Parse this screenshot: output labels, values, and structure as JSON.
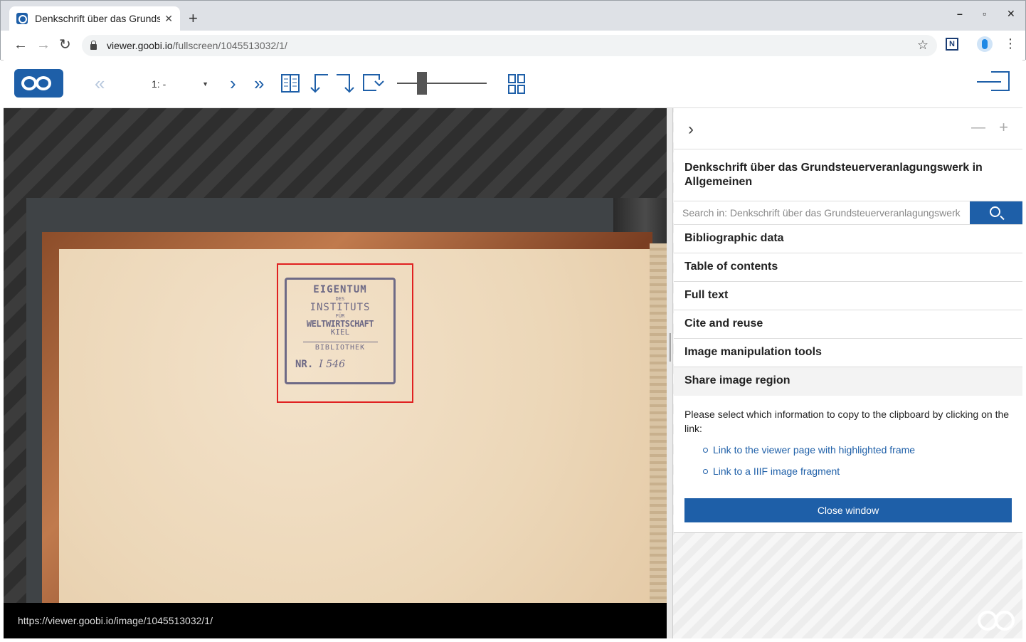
{
  "browser": {
    "tab_title": "Denkschrift über das Grundsteuerveranlagungswerk",
    "url_host": "viewer.goobi.io",
    "url_path": "/fullscreen/1045513032/1/",
    "ext_label": "N"
  },
  "viewer": {
    "page_select_value": "1: -",
    "status_url": "https://viewer.goobi.io/image/1045513032/1/",
    "stamp": {
      "line1": "EIGENTUM",
      "line2": "DES",
      "line3": "INSTITUTS",
      "line4": "FÜR",
      "line5": "WELTWIRTSCHAFT",
      "line6": "KIEL",
      "line7": "BIBLIOTHEK",
      "line8_label": "NR.",
      "line8_value": "I 546"
    }
  },
  "sidebar": {
    "title": "Denkschrift über das Grundsteuerveranlagungswerk in Allgemeinen",
    "search_placeholder": "Search in: Denkschrift über das Grundsteuerveranlagungswerk",
    "sections": [
      "Bibliographic data",
      "Table of contents",
      "Full text",
      "Cite and reuse",
      "Image manipulation tools",
      "Share image region"
    ],
    "share": {
      "instruction": "Please select which information to copy to the clipboard by clicking on the link:",
      "link1": "Link to the viewer page with highlighted frame",
      "link2": "Link to a IIIF image fragment",
      "close_label": "Close window"
    }
  },
  "colors": {
    "accent": "#1e5fa8",
    "highlight": "#e02020"
  }
}
